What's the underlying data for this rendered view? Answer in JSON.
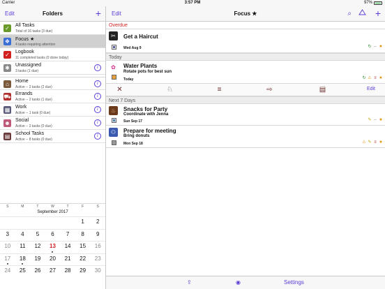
{
  "status_bar": {
    "carrier": "Carrier",
    "time": "3:57 PM",
    "battery": "97%",
    "battery_level": 0.97
  },
  "left": {
    "edit": "Edit",
    "title": "Folders",
    "add": "+",
    "folders": [
      {
        "name": "All Tasks",
        "sub": "Total of 16 tasks (3 due)",
        "icon": "all-tasks-icon",
        "color": "#6a9a2a",
        "glyph": "✓"
      },
      {
        "name": "Focus ★",
        "sub": "4 tasks requiring attention",
        "icon": "focus-icon",
        "color": "#3b6fd6",
        "glyph": "❖"
      },
      {
        "name": "Logbook",
        "sub": "11 completed tasks (0 done today)",
        "icon": "logbook-icon",
        "color": "#d02020",
        "glyph": "✓"
      },
      {
        "name": "Unassigned",
        "sub": "3 tasks (1 due)",
        "icon": "unassigned-icon",
        "color": "#888888",
        "glyph": "✱"
      }
    ],
    "contexts": [
      {
        "name": "Home",
        "sub": "Active -- 2 tasks (2 due)",
        "icon": "home-icon",
        "color": "#7a5a3a",
        "glyph": "⌂"
      },
      {
        "name": "Errands",
        "sub": "Active -- 2 tasks (1 due)",
        "icon": "errands-icon",
        "color": "#b03030",
        "glyph": "⛟"
      },
      {
        "name": "Work",
        "sub": "Active -- 1 task (0 due)",
        "icon": "work-icon",
        "color": "#5a5a7a",
        "glyph": "▦"
      },
      {
        "name": "Social",
        "sub": "Active -- 2 tasks (0 due)",
        "icon": "social-icon",
        "color": "#c05a7a",
        "glyph": "☻"
      },
      {
        "name": "School Tasks",
        "sub": "Active -- 8 tasks (0 due)",
        "icon": "school-icon",
        "color": "#6a3a3a",
        "glyph": "▤"
      }
    ],
    "info": "i"
  },
  "calendar": {
    "weekdays": [
      "S",
      "M",
      "T",
      "W",
      "T",
      "F",
      "S"
    ],
    "month": "September 2017",
    "weeks": [
      [
        {
          "d": ""
        },
        {
          "d": ""
        },
        {
          "d": ""
        },
        {
          "d": ""
        },
        {
          "d": ""
        },
        {
          "d": "1"
        },
        {
          "d": "2"
        }
      ],
      [
        {
          "d": "3"
        },
        {
          "d": "4"
        },
        {
          "d": "5"
        },
        {
          "d": "6"
        },
        {
          "d": "7"
        },
        {
          "d": "8"
        },
        {
          "d": "9"
        }
      ],
      [
        {
          "d": "10",
          "m": true
        },
        {
          "d": "11"
        },
        {
          "d": "12"
        },
        {
          "d": "13",
          "today": true,
          "dot": true
        },
        {
          "d": "14"
        },
        {
          "d": "15"
        },
        {
          "d": "16",
          "m": true
        }
      ],
      [
        {
          "d": "17",
          "m": true,
          "dot": true
        },
        {
          "d": "18",
          "dot": true
        },
        {
          "d": "19"
        },
        {
          "d": "20"
        },
        {
          "d": "21"
        },
        {
          "d": "22"
        },
        {
          "d": "23",
          "m": true
        }
      ],
      [
        {
          "d": "24",
          "m": true
        },
        {
          "d": "25"
        },
        {
          "d": "26"
        },
        {
          "d": "27"
        },
        {
          "d": "28"
        },
        {
          "d": "29"
        },
        {
          "d": "30",
          "m": true
        }
      ]
    ]
  },
  "right": {
    "edit": "Edit",
    "title": "Focus ★",
    "add": "+",
    "sections": {
      "overdue": "Overdue",
      "today": "Today",
      "next7": "Next 7 Days"
    },
    "tasks": {
      "haircut": {
        "title": "Get a Haircut",
        "note": "",
        "date": "Wed Aug 9"
      },
      "water": {
        "title": "Water Plants",
        "note": "Rotate pots for best sun",
        "date": "Today"
      },
      "snacks": {
        "title": "Snacks for Party",
        "note": "Coordinate with Jenna",
        "date": "Sun Sep 17"
      },
      "meeting": {
        "title": "Prepare for meeting",
        "note": "Bring donuts",
        "date": "Mon Sep 18"
      }
    },
    "toolbar_edit": "Edit",
    "bottom": {
      "settings": "Settings"
    }
  }
}
